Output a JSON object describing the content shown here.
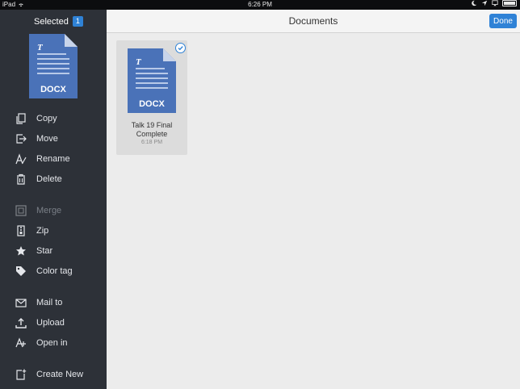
{
  "status_bar": {
    "device": "iPad",
    "time": "6:26 PM"
  },
  "sidebar": {
    "selected_label": "Selected",
    "selected_count": "1",
    "preview_file_type": "DOCX",
    "items": [
      {
        "label": "Copy",
        "icon": "copy-icon",
        "enabled": true
      },
      {
        "label": "Move",
        "icon": "move-icon",
        "enabled": true
      },
      {
        "label": "Rename",
        "icon": "rename-icon",
        "enabled": true
      },
      {
        "label": "Delete",
        "icon": "trash-icon",
        "enabled": true
      },
      {
        "label": "Merge",
        "icon": "merge-icon",
        "enabled": false
      },
      {
        "label": "Zip",
        "icon": "zip-icon",
        "enabled": true
      },
      {
        "label": "Star",
        "icon": "star-icon",
        "enabled": true
      },
      {
        "label": "Color tag",
        "icon": "tag-icon",
        "enabled": true
      },
      {
        "label": "Mail to",
        "icon": "mail-icon",
        "enabled": true
      },
      {
        "label": "Upload",
        "icon": "upload-icon",
        "enabled": true
      },
      {
        "label": "Open in",
        "icon": "open-in-icon",
        "enabled": true
      },
      {
        "label": "Create New",
        "icon": "create-new-icon",
        "enabled": true
      }
    ]
  },
  "navbar": {
    "title": "Documents",
    "done_label": "Done"
  },
  "files": [
    {
      "name_line1": "Talk 19 Final",
      "name_line2": "Complete",
      "time": "6:18 PM",
      "type": "DOCX",
      "selected": true
    }
  ],
  "colors": {
    "accent": "#2f82d6",
    "doc_blue": "#4a72b8",
    "sidebar_bg": "#2d3138"
  }
}
